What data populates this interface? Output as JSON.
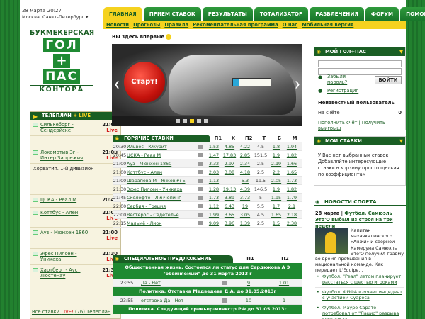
{
  "header": {
    "date": "28 марта 20:27",
    "city": "Москва, Санкт-Петербург ▾"
  },
  "tabs": [
    "ГЛАВНАЯ",
    "ПРИЕМ СТАВОК",
    "РЕЗУЛЬТАТЫ",
    "ТОТАЛИЗАТОР",
    "РАЗВЛЕЧЕНИЯ",
    "ФОРУМ",
    "ПОМОЩЬ"
  ],
  "subnav": [
    "Новости",
    "Прогнозы",
    "Правила",
    "Рекомендательная программа",
    "О нас",
    "Мобильная версия"
  ],
  "logo": {
    "top": "БУКМЕКЕРСКАЯ",
    "word1": "ГОЛ",
    "plus": "+",
    "word2": "ПАС",
    "bottom": "КОНТОРА"
  },
  "live": {
    "title": "ТЕЛЕПЛАН",
    "title_live": "+ LIVE",
    "items": [
      {
        "name": "Силькеборг - Сендерйскe",
        "time": "21:00",
        "live": "Live"
      },
      {
        "name": "Локомотив Зг - Интер Запрежич",
        "time": "21:00",
        "live": "Live"
      },
      {
        "name": "ЦСКА - Реал М",
        "time": "20:45",
        "live": ""
      },
      {
        "name": "Коттбус - Ален",
        "time": "21:00",
        "live": "Live"
      },
      {
        "name": "Ауз - Мюнхен 1860",
        "time": "21:00",
        "live": "Live"
      },
      {
        "name": "Эфес Пилсен - Уникаха",
        "time": "21:30",
        "live": "Live"
      },
      {
        "name": "Хартберг - Ауст Люстенау",
        "time": "21:30",
        "live": "Live"
      }
    ],
    "note": "Хорватия. 1-й дивизион",
    "more_pre": "Все ставки",
    "more_live": "LIVE!",
    "more_post": "(76) Телеплан"
  },
  "here_first": "Вы здесь впервые",
  "banner": {
    "button": "Старт!",
    "prev": "❮",
    "next": "❯"
  },
  "hot": {
    "title": "ГОРЯЧИЕ СТАВКИ",
    "cols": [
      "П1",
      "Х",
      "П2",
      "Т",
      "Б",
      "М"
    ],
    "rows": [
      {
        "t": "20:30",
        "ev": "Ильвес - Юкурит",
        "o": [
          "1.52",
          "4.85",
          "4.22",
          "4.5",
          "1.8",
          "1.94"
        ]
      },
      {
        "t": "20:45",
        "ev": "ЦСКА - Реал М",
        "o": [
          "1.47",
          "17.83",
          "2.85",
          "151.5",
          "1.9",
          "1.82"
        ]
      },
      {
        "t": "21:00",
        "ev": "Ауз - Мюнхен 1860",
        "o": [
          "3.32",
          "2.97",
          "2.34",
          "2.5",
          "2.19",
          "1.66"
        ]
      },
      {
        "t": "21:00",
        "ev": "Коттбус - Ален",
        "o": [
          "2.03",
          "3.08",
          "4.18",
          "2.5",
          "2.2",
          "1.65"
        ]
      },
      {
        "t": "21:00",
        "ev": "Шарапова М - Янкович Е",
        "o": [
          "1.13",
          "",
          "5.3",
          "19.5",
          "2.05",
          "1.73"
        ]
      },
      {
        "t": "21:30",
        "ev": "Эфес Пилсен - Уникаха",
        "o": [
          "1.28",
          "19.13",
          "4.39",
          "146.5",
          "1.9",
          "1.82"
        ]
      },
      {
        "t": "21:45",
        "ev": "Скелефте - Линчепинг",
        "o": [
          "1.73",
          "3.89",
          "3.73",
          "5",
          "1.95",
          "1.79"
        ]
      },
      {
        "t": "22:00",
        "ev": "Сербия - Греция",
        "o": [
          "1.12",
          "6.43",
          "19",
          "5.5",
          "1.7",
          "2.1"
        ]
      },
      {
        "t": "22:00",
        "ev": "Вестерос - Седетелье",
        "o": [
          "1.99",
          "3.65",
          "3.05",
          "4.5",
          "1.65",
          "2.18"
        ]
      },
      {
        "t": "22:15",
        "ev": "Мальмё - Лион",
        "o": [
          "9.09",
          "3.96",
          "1.39",
          "2.5",
          "1.5",
          "2.38"
        ]
      }
    ]
  },
  "special": {
    "title": "СПЕЦИАЛЬНОЕ ПРЕДЛОЖЕНИЕ",
    "cols": [
      "П1",
      "П2"
    ],
    "q1": "Общественная жизнь. Состоится ли статус для Сердюкова А Э \"обвиняемый\" до 31 марта 2013 г",
    "r1": {
      "t": "23:55",
      "ev": "Да - Нет",
      "o1": "9",
      "o2": "1.01"
    },
    "q2": "Политика. Отставка Медведева Д.А. до 31.05.2013г",
    "r2": {
      "t": "23:55",
      "ev": "отставка Да - Нет",
      "o1": "10",
      "o2": "1"
    },
    "q3": "Политика. Следующий премьер-министр РФ до 31.05.2013г"
  },
  "account": {
    "title": "МОЙ ГОЛ+ПАС",
    "forgot": "Забыли пароль?",
    "register": "Регистрация",
    "login": "ВОЙТИ",
    "unknown": "Неизвестный пользователь",
    "balance_label": "На счёте",
    "balance": "0",
    "topup": "Пополнить счёт",
    "win": "Получить выигрыш"
  },
  "bets": {
    "title": "МОИ СТАВКИ",
    "text": "У Вас нет выбранных ставок Добавляйте интересующие ставки в корзину простo щелкая по коэффициентам"
  },
  "news": {
    "title": "НОВОСТИ СПОРТА",
    "main_date": "28 марта",
    "main_link": "Футбол. Самюэль Это'О выбыл из строя на три недели",
    "body": "Капитан махачкалинского «Анжи» и сборной Камеруна Самюэль Это'О получил травму",
    "body2": "во время пребывания в национальной команде. Как передает L'Equipe...",
    "items": [
      "Футбол. \"Реал\" летом планирует расстаться с шестью игроками",
      "Футбол. ФИФА изучает инцидент с участием Суареса",
      "Футбол. Мауро Сарате потребовал от \"Лацио\" разрыва контракта"
    ]
  }
}
